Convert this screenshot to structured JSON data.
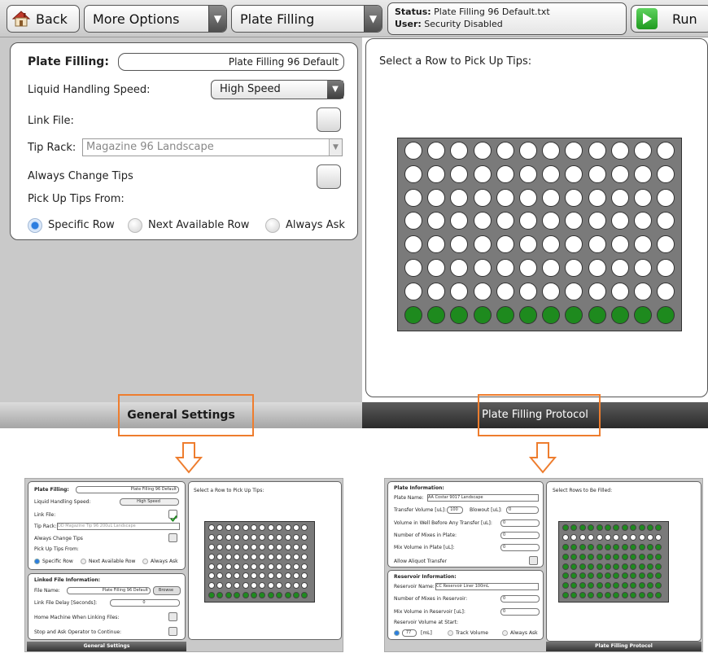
{
  "toolbar": {
    "back_label": "Back",
    "more_options_label": "More Options",
    "protocol_select": "Plate Filling",
    "status_label": "Status:",
    "status_value": "Plate Filling 96 Default.txt",
    "user_label": "User:",
    "user_value": "Security Disabled",
    "run_label": "Run"
  },
  "settings": {
    "plate_filling_label": "Plate Filling:",
    "plate_filling_value": "Plate Filling 96 Default",
    "speed_label": "Liquid Handling Speed:",
    "speed_value": "High Speed",
    "link_file_label": "Link File:",
    "tip_rack_label": "Tip Rack:",
    "tip_rack_value": "Magazine 96 Landscape",
    "always_change_label": "Always Change Tips",
    "pick_up_label": "Pick Up Tips From:",
    "pickup_options": [
      "Specific Row",
      "Next Available Row",
      "Always Ask"
    ],
    "pickup_selected": "Specific Row"
  },
  "plate": {
    "instruction": "Select a Row to Pick Up Tips:",
    "rows": 8,
    "columns": 12,
    "selected_row": 8
  },
  "tabs": {
    "general": "General Settings",
    "protocol": "Plate Filling Protocol"
  },
  "thumb_left": {
    "plate_filling_label": "Plate Filling:",
    "plate_filling_value": "Plate Filling 96 Default",
    "speed_label": "Liquid Handling Speed:",
    "speed_value": "High Speed",
    "link_file_label": "Link File:",
    "tip_rack_label": "Tip Rack:",
    "tip_rack_value": "DD Magazine Tip 96 200uL Landscape",
    "always_change_label": "Always Change Tips",
    "pick_up_label": "Pick Up Tips From:",
    "pickup_options": [
      "Specific Row",
      "Next Available Row",
      "Always Ask"
    ],
    "linked_header": "Linked File Information:",
    "file_name_label": "File Name:",
    "file_name_value": "Plate Filling 96 Default",
    "browse_label": "Browse",
    "delay_label": "Link File Delay [Seconds]:",
    "delay_value": "0",
    "home_label": "Home Machine When Linking Files:",
    "stop_label": "Stop and Ask Operator to Continue:",
    "instruction": "Select a Row to Pick Up Tips:",
    "tab_label": "General Settings"
  },
  "thumb_right": {
    "plate_info_header": "Plate Information:",
    "plate_name_label": "Plate Name:",
    "plate_name_value": "AA Costar 9017 Landscape",
    "transfer_label": "Transfer Volume [uL]:",
    "transfer_value": "100",
    "blowout_label": "Blowout [uL]:",
    "blowout_value": "0",
    "vol_well_label": "Volume in Well Before Any Transfer [uL]:",
    "vol_well_value": "0",
    "mixes_plate_label": "Number of Mixes in Plate:",
    "mixes_plate_value": "0",
    "mix_vol_plate_label": "Mix Volume in Plate [uL]:",
    "mix_vol_plate_value": "0",
    "aliquot_label": "Allow Aliquot Transfer",
    "reservoir_header": "Reservoir Information:",
    "reservoir_name_label": "Reservoir Name:",
    "reservoir_name_value": "CC Reservoir Liner 100mL",
    "mixes_res_label": "Number of Mixes in Reservoir:",
    "mixes_res_value": "0",
    "mix_vol_res_label": "Mix Volume in Reservoir [uL]:",
    "mix_vol_res_value": "0",
    "res_vol_label": "Reservoir Volume at Start:",
    "res_vol_value": "77",
    "res_vol_unit": "[mL]",
    "track_label": "Track Volume",
    "always_ask_label": "Always Ask",
    "instruction": "Select Rows to Be Filled:",
    "tab_label": "Plate Filling Protocol",
    "empty_row": 2
  }
}
